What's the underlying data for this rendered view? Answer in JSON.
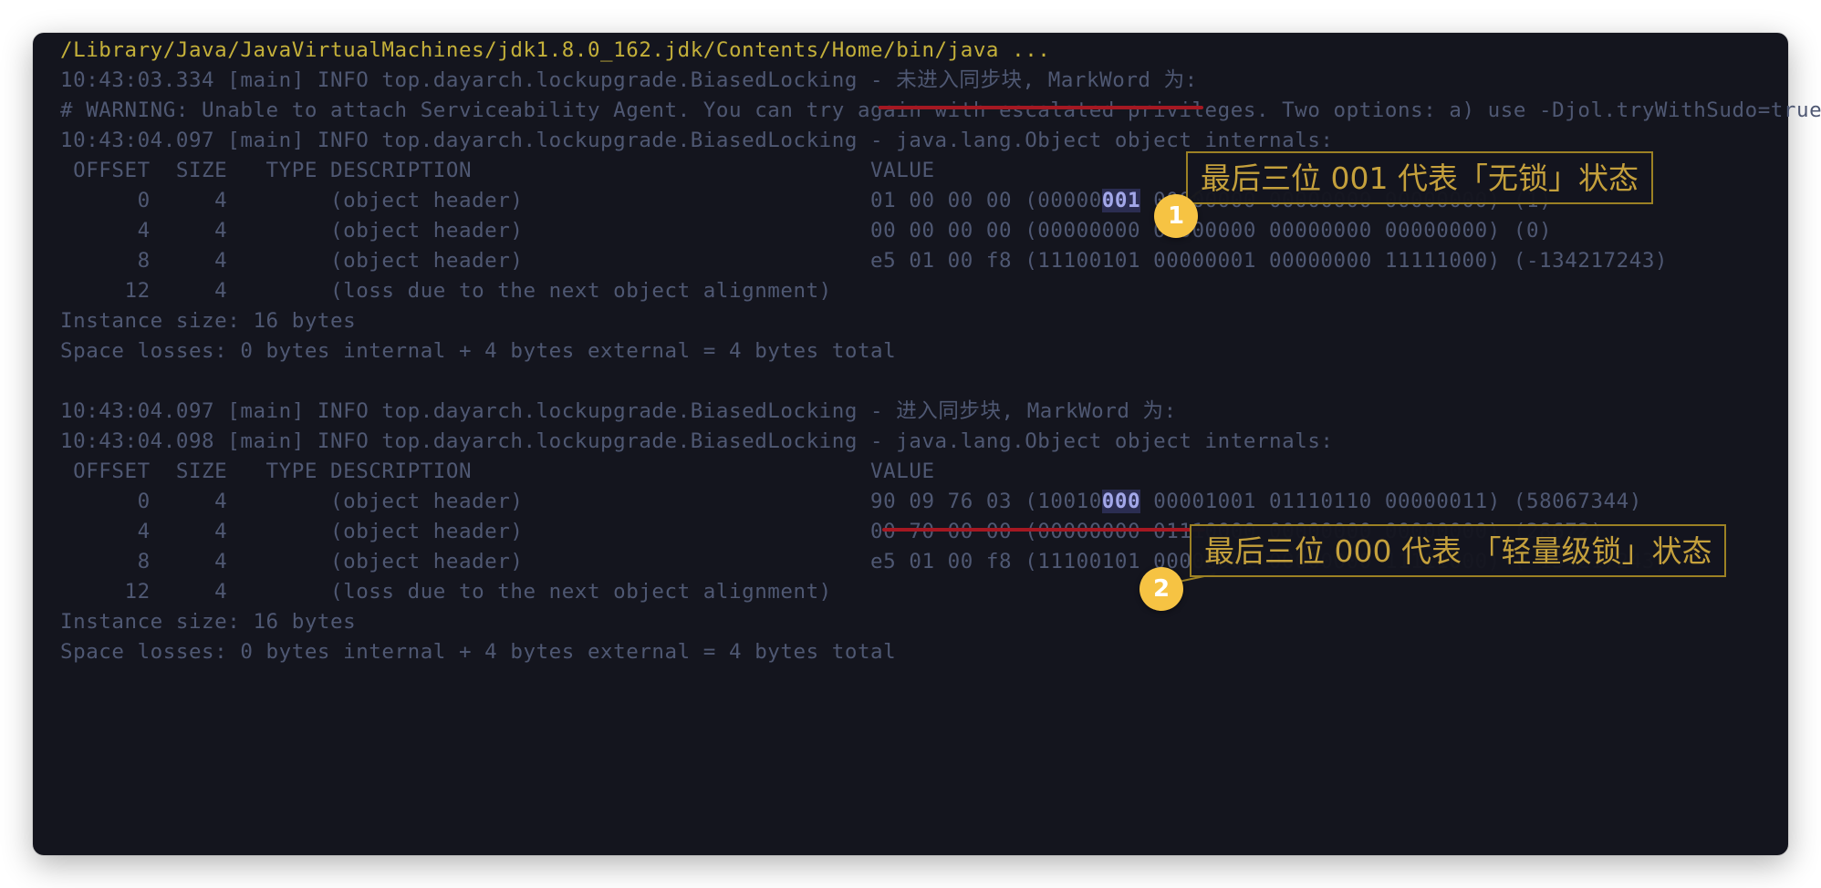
{
  "console": {
    "lines": [
      {
        "text": "/Library/Java/JavaVirtualMachines/jdk1.8.0_162.jdk/Contents/Home/bin/java ..."
      },
      {
        "text": "10:43:03.334 [main] INFO top.dayarch.lockupgrade.BiasedLocking - 未进入同步块, MarkWord 为:"
      },
      {
        "text": "# WARNING: Unable to attach Serviceability Agent. You can try again with escalated privileges. Two options: a) use -Djol.tryWithSudo=true"
      },
      {
        "text": "10:43:04.097 [main] INFO top.dayarch.lockupgrade.BiasedLocking - java.lang.Object object internals:"
      },
      {
        "text": " OFFSET  SIZE   TYPE DESCRIPTION                               VALUE"
      },
      {
        "pre": "      0     4        (object header)                           01 00 00 00 (00000",
        "hl": "001",
        "post": " 00000000 00000000 00000000) (1)"
      },
      {
        "text": "      4     4        (object header)                           00 00 00 00 (00000000 00000000 00000000 00000000) (0)"
      },
      {
        "text": "      8     4        (object header)                           e5 01 00 f8 (11100101 00000001 00000000 11111000) (-134217243)"
      },
      {
        "text": "     12     4        (loss due to the next object alignment)"
      },
      {
        "text": "Instance size: 16 bytes"
      },
      {
        "text": "Space losses: 0 bytes internal + 4 bytes external = 4 bytes total"
      },
      {
        "text": ""
      },
      {
        "text": "10:43:04.097 [main] INFO top.dayarch.lockupgrade.BiasedLocking - 进入同步块, MarkWord 为:"
      },
      {
        "text": "10:43:04.098 [main] INFO top.dayarch.lockupgrade.BiasedLocking - java.lang.Object object internals:"
      },
      {
        "text": " OFFSET  SIZE   TYPE DESCRIPTION                               VALUE"
      },
      {
        "pre": "      0     4        (object header)                           90 09 76 03 (10010",
        "hl": "000",
        "post": " 00001001 01110110 00000011) (58067344)"
      },
      {
        "text": "      4     4        (object header)                           00 70 00 00 (00000000 01110000 00000000 00000000) (28672)"
      },
      {
        "text": "      8     4        (object header)                           e5 01 00 f8 (11100101 00000001 00000000 11111000) (-134217243)"
      },
      {
        "text": "     12     4        (loss due to the next object alignment)"
      },
      {
        "text": "Instance size: 16 bytes"
      },
      {
        "text": "Space losses: 0 bytes internal + 4 bytes external = 4 bytes total"
      }
    ]
  },
  "annotations": {
    "callout_1": {
      "badge": "1",
      "text": "最后三位 001 代表「无锁」状态"
    },
    "callout_2": {
      "badge": "2",
      "text": "最后三位 000 代表 「轻量级锁」状态"
    }
  },
  "colors": {
    "background": "#14151e",
    "text": "#4f5873",
    "path": "#c4b03a",
    "highlight": "#a3a8ea",
    "underline": "#a51822",
    "callout": "#c4a03c",
    "badge": "#f6c343"
  }
}
